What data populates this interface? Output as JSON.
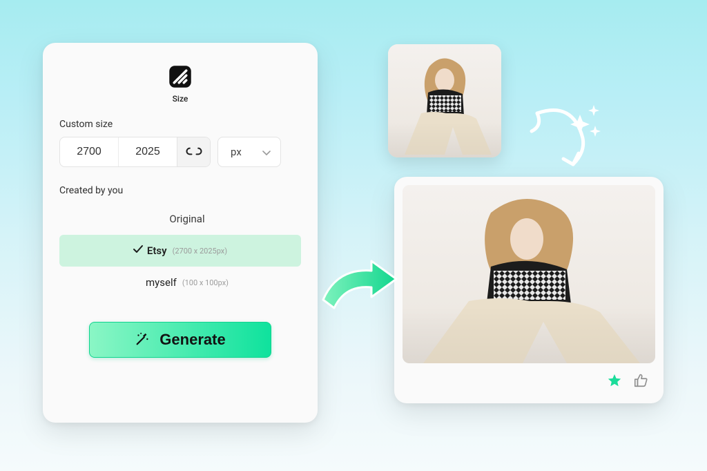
{
  "panel": {
    "icon_label": "Size",
    "custom_size_label": "Custom size",
    "width_value": "2700",
    "height_value": "2025",
    "unit": "px",
    "created_by_label": "Created by you",
    "presets": [
      {
        "name": "Original",
        "dims": "",
        "selected": false
      },
      {
        "name": "Etsy",
        "dims": "(2700 x 2025px)",
        "selected": true
      },
      {
        "name": "myself",
        "dims": "(100 x 100px)",
        "selected": false
      }
    ],
    "generate_label": "Generate"
  },
  "icons": {
    "size": "size-icon",
    "link": "link-icon",
    "chevron_down": "chevron-down-icon",
    "check": "check-icon",
    "wand": "wand-icon",
    "star": "star-icon",
    "thumbs_up": "thumbs-up-icon",
    "sparkles": "sparkles-icon",
    "arrow_right": "arrow-right-icon",
    "arrow_curve": "arrow-curve-icon"
  },
  "colors": {
    "accent": "#1bdc9a",
    "selected_bg": "#cdf3df"
  }
}
